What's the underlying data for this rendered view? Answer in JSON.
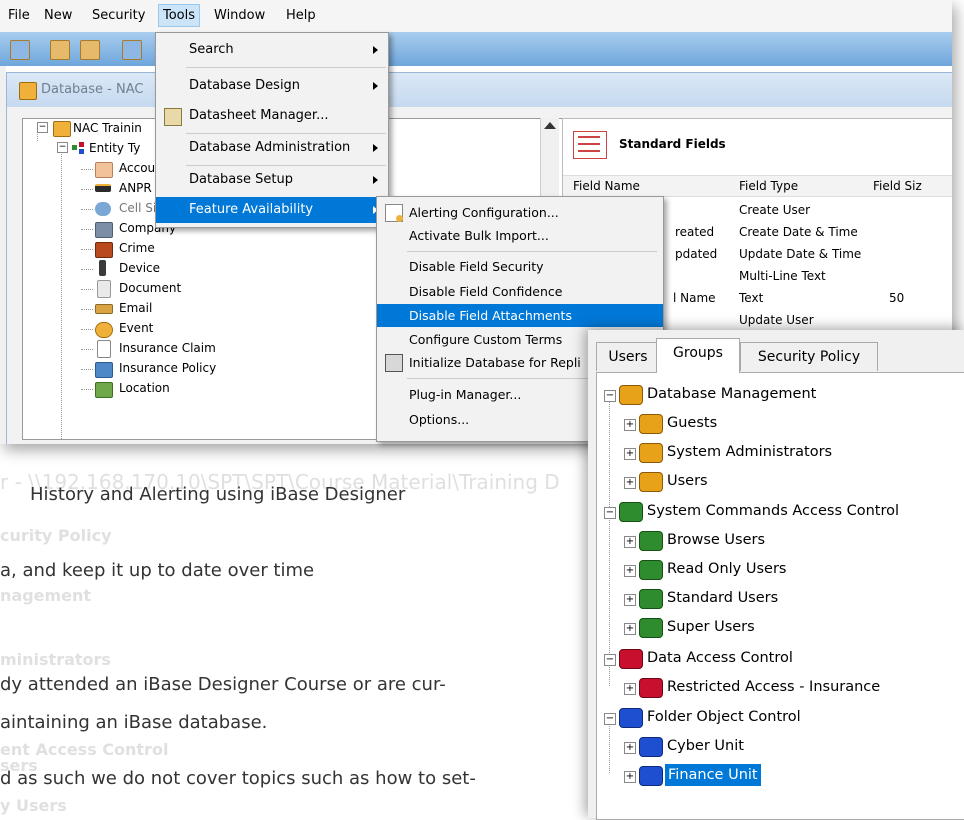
{
  "background_document": {
    "lines": [
      "History and Alerting using iBase Designer",
      "a, and keep it up to date over time",
      "dy attended an iBase Designer Course or are cur-",
      "aintaining an iBase database.",
      "d as such we do not cover topics such as how to set-"
    ],
    "ghost_title": "r - \\\\192.168.170.10\\SPT\\SPT\\Course Material\\Training D",
    "ghost_lines": [
      "curity Policy",
      "nagement",
      "ministrators",
      "ent Access Control",
      "sers",
      "y Users"
    ]
  },
  "menubar": {
    "items": [
      "File",
      "New",
      "Security",
      "Tools",
      "Window",
      "Help"
    ],
    "open_item": "Tools"
  },
  "database_window": {
    "title": "Database - NAC"
  },
  "tree": {
    "root": "NAC Trainin",
    "entity_types": "Entity Ty",
    "items": [
      "Accou",
      "ANPR",
      "Cell Si",
      "Company",
      "Crime",
      "Device",
      "Document",
      "Email",
      "Event",
      "Insurance Claim",
      "Insurance Policy",
      "Location"
    ]
  },
  "standard_fields": {
    "title": "Standard Fields",
    "columns": [
      "Field Name",
      "Field Type",
      "Field Siz"
    ],
    "rows": [
      {
        "name": "",
        "type": "Create User",
        "size": ""
      },
      {
        "name": "reated",
        "type": "Create Date & Time",
        "size": ""
      },
      {
        "name": "pdated",
        "type": "Update Date & Time",
        "size": ""
      },
      {
        "name": "",
        "type": "Multi-Line Text",
        "size": ""
      },
      {
        "name": "l Name",
        "type": "Text",
        "size": "50"
      },
      {
        "name": "",
        "type": "Update User",
        "size": ""
      }
    ]
  },
  "tools_menu": {
    "items": [
      {
        "label": "Search",
        "submenu": true
      },
      {
        "label": "Database Design",
        "submenu": true
      },
      {
        "label": "Datasheet Manager...",
        "submenu": false
      },
      {
        "label": "Database Administration",
        "submenu": true
      },
      {
        "label": "Database Setup",
        "submenu": true
      },
      {
        "label": "Feature Availability",
        "submenu": true
      }
    ],
    "highlighted": "Feature Availability"
  },
  "feature_submenu": {
    "items": [
      "Alerting Configuration...",
      "Activate Bulk Import...",
      "Disable Field Security",
      "Disable Field Confidence",
      "Disable Field Attachments",
      "Configure Custom Terms",
      "Initialize Database for Repli",
      "Plug-in Manager...",
      "Options..."
    ],
    "highlighted": "Disable Field Attachments"
  },
  "security_dialog": {
    "tabs": [
      "Users",
      "Groups",
      "Security Policy"
    ],
    "active_tab": "Groups",
    "groups": [
      {
        "label": "Database Management",
        "color": "#e8a21a",
        "children": [
          "Guests",
          "System Administrators",
          "Users"
        ]
      },
      {
        "label": "System Commands Access Control",
        "color": "#2e8b2e",
        "children": [
          "Browse Users",
          "Read Only Users",
          "Standard Users",
          "Super Users"
        ]
      },
      {
        "label": "Data Access Control",
        "color": "#c8102e",
        "children": [
          "Restricted Access -  Insurance"
        ]
      },
      {
        "label": "Folder Object Control",
        "color": "#1f4fd1",
        "children": [
          "Cyber Unit",
          "Finance Unit"
        ]
      }
    ],
    "selected": "Finance Unit"
  }
}
